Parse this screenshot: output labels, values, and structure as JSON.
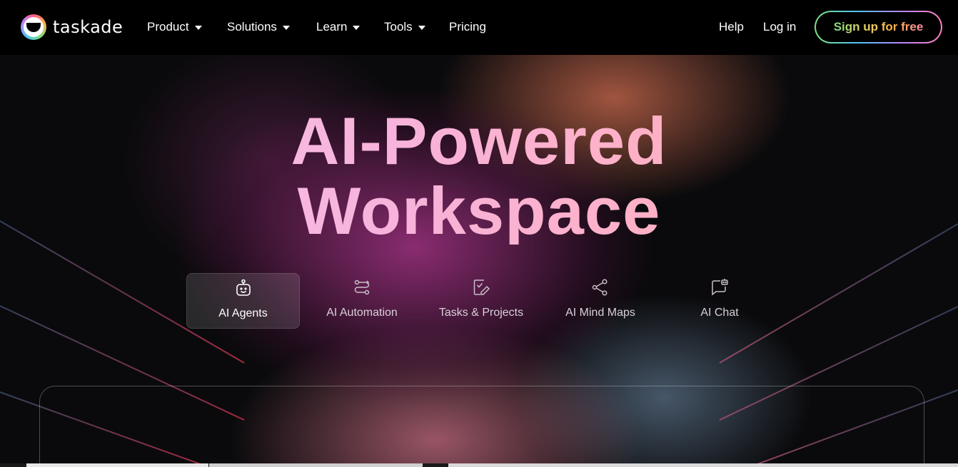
{
  "brand": {
    "name": "taskade"
  },
  "nav": {
    "items": [
      {
        "label": "Product",
        "dropdown": true
      },
      {
        "label": "Solutions",
        "dropdown": true
      },
      {
        "label": "Learn",
        "dropdown": true
      },
      {
        "label": "Tools",
        "dropdown": true
      },
      {
        "label": "Pricing",
        "dropdown": false
      }
    ],
    "help": "Help",
    "login": "Log in",
    "signup": "Sign up for free"
  },
  "hero": {
    "title_line1": "AI-Powered",
    "title_line2": "Workspace"
  },
  "tabs": [
    {
      "label": "AI Agents",
      "icon": "robot-icon",
      "active": true
    },
    {
      "label": "AI Automation",
      "icon": "automation-flow-icon",
      "active": false
    },
    {
      "label": "Tasks & Projects",
      "icon": "task-edit-icon",
      "active": false
    },
    {
      "label": "AI Mind Maps",
      "icon": "share-nodes-icon",
      "active": false
    },
    {
      "label": "AI Chat",
      "icon": "chat-bot-icon",
      "active": false
    }
  ],
  "colors": {
    "headline_gradient": [
      "#f6c8ea",
      "#ffb0c4"
    ],
    "signup_border": [
      "#7ee081",
      "#4fc3f7",
      "#b388ff",
      "#ff7eb6"
    ],
    "background": "#000000"
  }
}
